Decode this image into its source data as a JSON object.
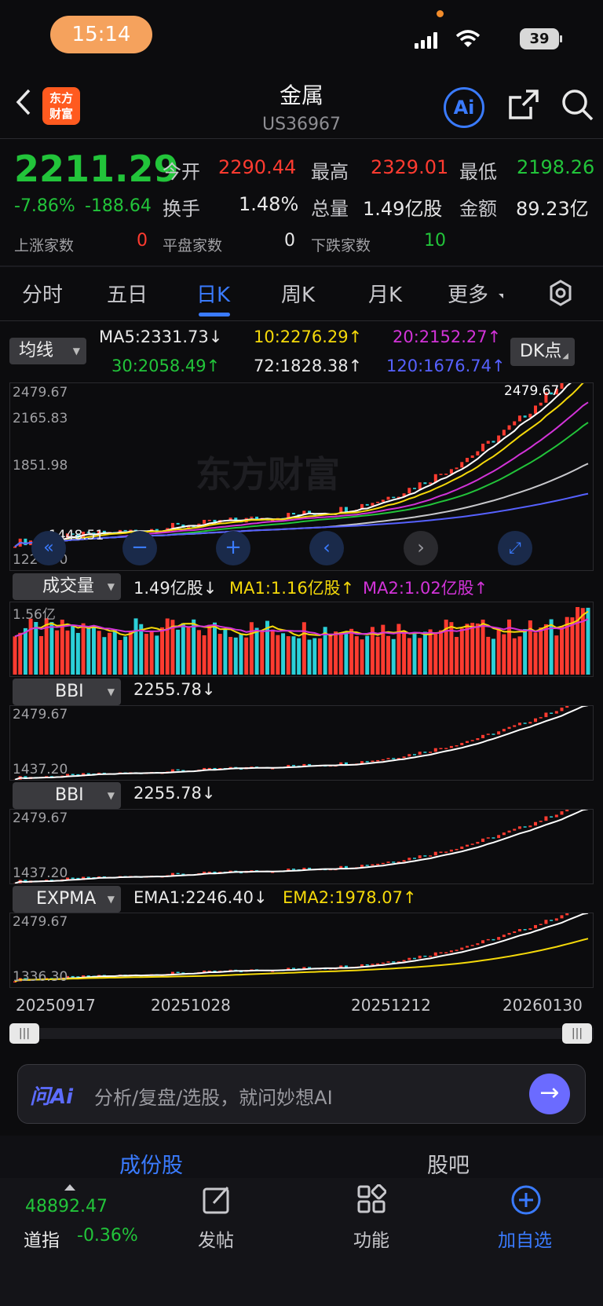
{
  "status_bar": {
    "time": "15:14",
    "battery": "39"
  },
  "header": {
    "title": "金属",
    "code": "US36967",
    "logo_text": "东方\n财富",
    "ai_label": "Ai"
  },
  "quote": {
    "price": "2211.29",
    "change_pct": "-7.86%",
    "change": "-188.64",
    "open_label": "今开",
    "open": "2290.44",
    "high_label": "最高",
    "high": "2329.01",
    "low_label": "最低",
    "low": "2198.26",
    "turnover_label": "换手",
    "turnover": "1.48%",
    "volume_label": "总量",
    "volume": "1.49亿股",
    "amount_label": "金额",
    "amount": "89.23亿",
    "up_label": "上涨家数",
    "up": "0",
    "flat_label": "平盘家数",
    "flat": "0",
    "down_label": "下跌家数",
    "down": "10"
  },
  "tabs": [
    "分时",
    "五日",
    "日K",
    "周K",
    "月K",
    "更多"
  ],
  "active_tab": "日K",
  "ma_bar": {
    "selector": "均线",
    "ma5": "MA5:2331.73↓",
    "ma10": "10:2276.29↑",
    "ma20": "20:2152.27↑",
    "ma30": "30:2058.49↑",
    "ma72": "72:1828.38↑",
    "ma120": "120:1676.74↑",
    "dk": "DK点"
  },
  "main_chart": {
    "y_labels": [
      "2479.67",
      "2165.83",
      "1851.98",
      "1448.51",
      "1224.30"
    ],
    "max_label": "2479.67"
  },
  "volume_bar": {
    "selector": "成交量",
    "vol": "1.49亿股↓",
    "ma1": "MA1:1.16亿股↑",
    "ma2": "MA2:1.02亿股↑",
    "ymax": "1.56亿"
  },
  "bbi1": {
    "selector": "BBI",
    "value": "2255.78↓",
    "ymax": "2479.67",
    "ymin": "1437.20"
  },
  "bbi2": {
    "selector": "BBI",
    "value": "2255.78↓",
    "ymax": "2479.67",
    "ymin": "1437.20"
  },
  "expma": {
    "selector": "EXPMA",
    "ema1": "EMA1:2246.40↓",
    "ema2": "EMA2:1978.07↑",
    "ymax": "2479.67",
    "ymin": "1336.30"
  },
  "dates": [
    "20250917",
    "20251028",
    "20251212",
    "20260130"
  ],
  "ai_input": {
    "logo": "问Ai",
    "placeholder": "分析/复盘/选股，就问妙想AI"
  },
  "sub_tabs": {
    "left": "成份股",
    "right": "股吧"
  },
  "bottom_nav": {
    "index_value": "48892.47",
    "index_name": "道指",
    "index_change": "-0.36%",
    "post": "发帖",
    "functions": "功能",
    "add_watch": "加自选"
  },
  "colors": {
    "up": "#ff3b30",
    "down": "#22c43a",
    "accent": "#3a7bff",
    "volume_down": "#2bd0d8"
  }
}
